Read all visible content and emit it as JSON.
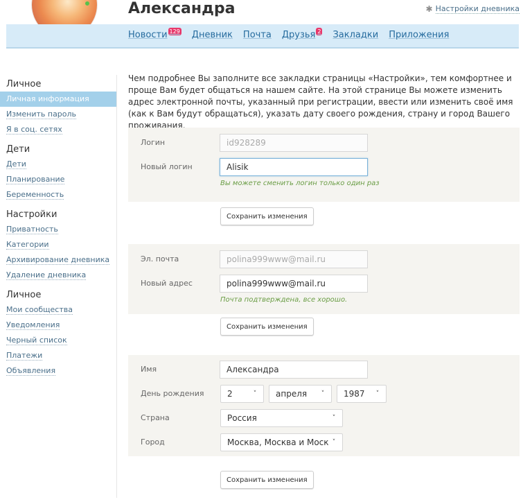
{
  "profile": {
    "name": "Александра"
  },
  "header": {
    "settings_link": "Настройки дневника",
    "settings_icon": "gear-icon"
  },
  "nav": {
    "items": [
      {
        "label": "Новости",
        "badge": "129"
      },
      {
        "label": "Дневник"
      },
      {
        "label": "Почта"
      },
      {
        "label": "Друзья",
        "badge": "2"
      },
      {
        "label": "Закладки"
      },
      {
        "label": "Приложения"
      }
    ]
  },
  "sidebar": {
    "groups": [
      {
        "title": "Личное",
        "items": [
          {
            "label": "Личная информация",
            "active": true
          },
          {
            "label": "Изменить пароль"
          },
          {
            "label": "Я в соц. сетях"
          }
        ]
      },
      {
        "title": "Дети",
        "items": [
          {
            "label": "Дети"
          },
          {
            "label": "Планирование"
          },
          {
            "label": "Беременность"
          }
        ]
      },
      {
        "title": "Настройки",
        "items": [
          {
            "label": "Приватность"
          },
          {
            "label": "Категории"
          },
          {
            "label": "Архивирование дневника"
          },
          {
            "label": "Удаление дневника"
          }
        ]
      },
      {
        "title": "Личное",
        "items": [
          {
            "label": "Мои сообщества"
          },
          {
            "label": "Уведомления"
          },
          {
            "label": "Черный список"
          },
          {
            "label": "Платежи"
          },
          {
            "label": "Объявления"
          }
        ]
      }
    ]
  },
  "main": {
    "intro": "Чем подробнее Вы заполните все закладки страницы «Настройки», тем комфортнее и проще Вам будет общаться на нашем сайте. На этой странице Вы можете изменить адрес электронной почты, указанный при регистрации, ввести или изменить своё имя (как к Вам будут обращаться), указать дату своего рождения, страну и город Вашего проживания.",
    "login": {
      "label": "Логин",
      "value": "id928289",
      "new_label": "Новый логин",
      "new_value": "Alisik",
      "hint": "Вы можете сменить логин только один раз",
      "save": "Сохранить изменения"
    },
    "email": {
      "label": "Эл. почта",
      "value": "polina999www@mail.ru",
      "new_label": "Новый адрес",
      "new_value": "polina999www@mail.ru",
      "hint": "Почта подтверждена, все хорошо.",
      "save": "Сохранить изменения"
    },
    "personal": {
      "name_label": "Имя",
      "name_value": "Александра",
      "birthday_label": "День рождения",
      "day": "2",
      "month": "апреля",
      "year": "1987",
      "country_label": "Страна",
      "country": "Россия",
      "city_label": "Город",
      "city": "Москва, Москва и Московская обл.",
      "save": "Сохранить изменения"
    }
  }
}
